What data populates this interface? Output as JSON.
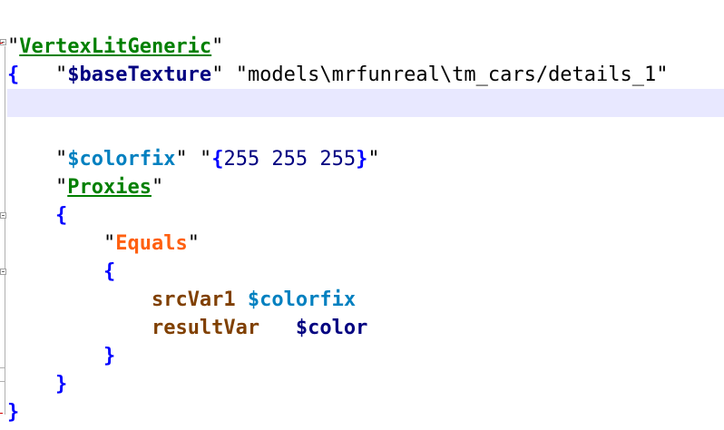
{
  "editor": {
    "shader_name": "VertexLitGeneric",
    "base_texture_key": "$baseTexture",
    "base_texture_value": "models\\mrfunreal\\tm_cars/details_1",
    "colorfix_key": "$colorfix",
    "colorfix_value": "255 255 255",
    "proxies_key": "Proxies",
    "proxy_name": "Equals",
    "src_var_key": "srcVar1",
    "src_var_value": "$colorfix",
    "result_var_key": "resultVar",
    "result_var_value": "$color",
    "open_brace": "{",
    "close_brace": "}",
    "quote": "\""
  },
  "colors": {
    "shader_name": "#008000",
    "braces": "#0000ff",
    "base_texture_key": "#000080",
    "colorfix_key": "#0080c0",
    "proxy_name": "#ff6010",
    "var_keys": "#804000",
    "current_line_bg": "#e8e8ff"
  }
}
